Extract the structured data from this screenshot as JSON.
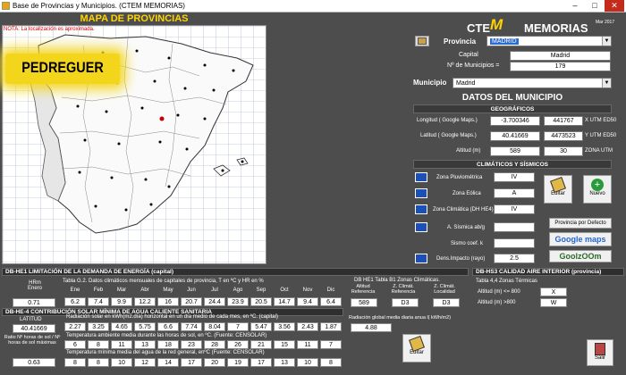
{
  "window": {
    "title": "Base de Provincias y Municipios. (CTEM MEMORIAS)",
    "min": "–",
    "max": "□",
    "close": "✕"
  },
  "map": {
    "title": "MAPA DE PROVINCIAS",
    "note": "NOTA: La localización es aproximada.",
    "logo_text": "PEDREGUER"
  },
  "brand": {
    "cte": "CTE",
    "m": "M",
    "memorias": "MEMORIAS",
    "version": "Mar 2017"
  },
  "province": {
    "label": "Provincia",
    "value": "MADRID",
    "capital_label": "Capital",
    "capital": "Madrid",
    "num_label": "Nº de Municipios =",
    "num": "179"
  },
  "municipio": {
    "label": "Municipio",
    "value": "Madrid"
  },
  "datos": {
    "title": "DATOS DEL MUNICIPIO",
    "geo_header": "GEOGRÁFICOS",
    "lon_label": "Longitud ( Google Maps.)",
    "lon": "-3.700346",
    "utm_x": "441767",
    "utm_x_label": "X UTM ED50",
    "lat_label": "Latitud ( Google Maps.)",
    "lat": "40.41669",
    "utm_y": "4473523",
    "utm_y_label": "Y UTM ED50",
    "alt_label": "Altitud (m)",
    "alt": "589",
    "zona": "30",
    "zona_label": "ZONA UTM",
    "clim_header": "CLIMÁTICOS Y SÍSMICOS",
    "pluv_label": "Zona Pluviométrica",
    "pluv": "IV",
    "eolica_label": "Zona  Eólica",
    "eolica": "A",
    "climatica_label": "Zona Climática (DH HE4)",
    "climatica": "IV",
    "sismica_label": "A. Sísmica  ab/g",
    "sismica": "",
    "coef_label": "Sismo coef.  k",
    "coef": "",
    "rayo_label": "Dens.Impacto (rayo)",
    "rayo": "2.5"
  },
  "buttons": {
    "editar": "Editar",
    "nuevo": "Nuevo",
    "defecto": "Provincia por Defecto",
    "googlemaps": "Google maps",
    "goolzoom": "GoolzOOm",
    "editar2": "Editar",
    "salir": "Salir"
  },
  "he1": {
    "header": "DB-HE1 LIMITACIÓN DE LA DEMANDA DE ENERGÍA (capital)",
    "hrm_label": "HRm Enero",
    "hrm": "0.71",
    "tabla_label": "Tabla G.2. Datos climáticos mensuales de capitales de provincia, T en ºC y HR en %",
    "months": [
      "Ene",
      "Feb",
      "Mar",
      "Abr",
      "May",
      "Jun",
      "Jul",
      "Ago",
      "Sep",
      "Oct",
      "Nov",
      "Dic"
    ],
    "temps": [
      "6.2",
      "7.4",
      "9.9",
      "12.2",
      "16",
      "20.7",
      "24.4",
      "23.9",
      "20.5",
      "14.7",
      "9.4",
      "6.4"
    ],
    "b1_label": "DB HE1  Tabla B1 Zonas Climáticas.",
    "alt_ref_label": "Altitud Referencia",
    "z_ref_label": "Z. Climát. Referencia",
    "z_loc_label": "Z. Climát. Localidad",
    "alt_ref": "589",
    "z_ref": "D3",
    "z_loc": "D3"
  },
  "hs3": {
    "header": "DB-HS3 CALIDAD AIRE INTERIOR (provincia)",
    "tabla_label": "Tabla 4,4 Zonas Térmicas",
    "a800_label": "Altitud (m) <= 800",
    "a800": "X",
    "g800_label": "Altitud (m) >800",
    "g800": "W"
  },
  "he4": {
    "header": "DB-HE-4 CONTRIBUCIÓN SOLAR MÍNIMA DE AGUA CALIENTE SANITARIA",
    "lat_label": "LATITUD",
    "lat": "40.41669",
    "rad_label": "Radiación solar en kWh(m2.día) horizontal en un día medio de cada mes, en ºC. (capital)",
    "rad": [
      "2.27",
      "3.25",
      "4.65",
      "5.75",
      "6.6",
      "7.74",
      "8.04",
      "7",
      "5.47",
      "3.56",
      "2.43",
      "1.87"
    ],
    "rad_anual_label": "Radiación global media diaria anua l( kWh/m2)",
    "rad_anual": "4.88",
    "ratio_label": "Ratio Nº horas de sol / Nº horas de sol máximas",
    "ratio": "0.63",
    "tamb_label": "Temperatura ambiente media durante las horas de sol, en ºC. (Fuente: CENSOLAR)",
    "tamb": [
      "6",
      "8",
      "11",
      "13",
      "18",
      "23",
      "28",
      "26",
      "21",
      "15",
      "11",
      "7"
    ],
    "tagua_label": "Temperatura mínima media del agua de la red general, enºC (Fuente: CENSOLAR)",
    "tagua": [
      "8",
      "8",
      "10",
      "12",
      "14",
      "17",
      "20",
      "19",
      "17",
      "13",
      "10",
      "8"
    ]
  }
}
